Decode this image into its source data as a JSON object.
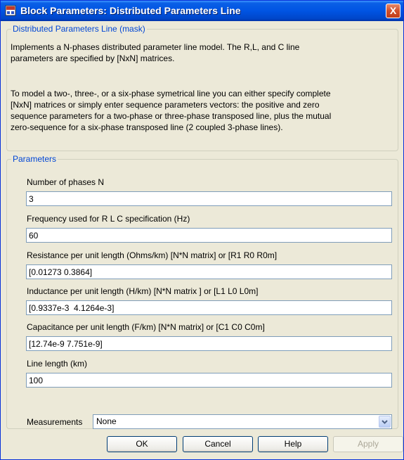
{
  "window": {
    "title": "Block Parameters: Distributed Parameters Line",
    "close_label": "X"
  },
  "mask_group": {
    "legend": "Distributed Parameters Line (mask)",
    "paragraph1": [
      "Implements a N-phases distributed parameter line model. The R,L, and C line",
      "parameters are specified by [NxN] matrices."
    ],
    "paragraph2": [
      "To model a two-, three-, or a six-phase symetrical line you can either specify complete",
      "[NxN] matrices or simply enter sequence parameters vectors: the  positive and zero",
      "sequence parameters for a two-phase or  three-phase transposed  line, plus the mutual",
      "zero-sequence for a  six-phase transposed  line  (2 coupled 3-phase lines)."
    ]
  },
  "params_group": {
    "legend": "Parameters",
    "fields": [
      {
        "label": "Number of phases N",
        "value": "3"
      },
      {
        "label": "Frequency used for R L C specification (Hz)",
        "value": "60"
      },
      {
        "label": "Resistance per unit length (Ohms/km)   [N*N matrix] or [R1 R0 R0m]",
        "value": "[0.01273 0.3864]"
      },
      {
        "label": "Inductance per unit length (H/km) [N*N matrix ] or [L1 L0 L0m]",
        "value": "[0.9337e-3  4.1264e-3]"
      },
      {
        "label": "Capacitance per unit length (F/km) [N*N matrix] or [C1 C0 C0m]",
        "value": "[12.74e-9 7.751e-9]"
      },
      {
        "label": "Line length (km)",
        "value": "100"
      }
    ],
    "measurements": {
      "label": "Measurements",
      "value": "None"
    }
  },
  "buttons": {
    "ok": "OK",
    "cancel": "Cancel",
    "help": "Help",
    "apply": "Apply"
  },
  "colors": {
    "titlebar": "#0054e3",
    "legend": "#0046d5",
    "dialog_bg": "#ece9d8"
  },
  "icons": {
    "title": "simulink-block-icon",
    "dropdown": "chevron-down-icon"
  }
}
